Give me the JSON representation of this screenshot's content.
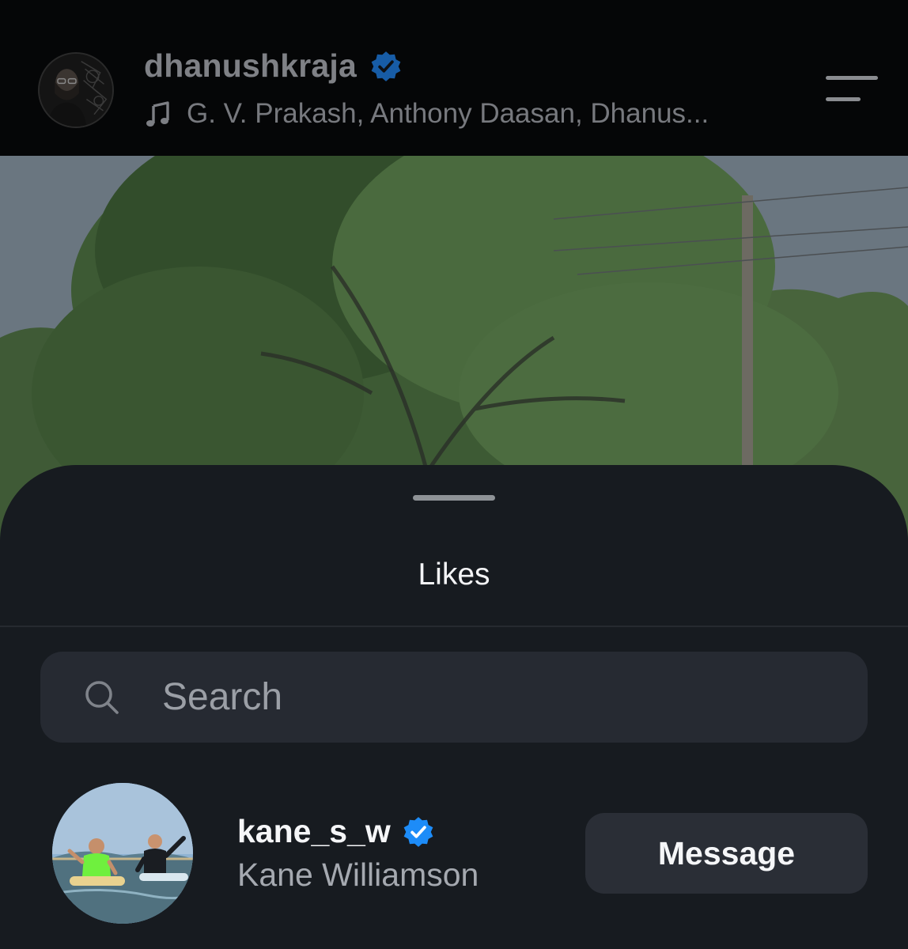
{
  "post_header": {
    "username": "dhanushkraja",
    "audio_text": "G. V. Prakash, Anthony Daasan, Dhanus...",
    "icons": {
      "verified": "verified-badge-icon",
      "music": "music-note-icon",
      "menu": "menu-lines-icon"
    }
  },
  "likes_sheet": {
    "title": "Likes",
    "search": {
      "placeholder": "Search",
      "value": ""
    },
    "rows": [
      {
        "username": "kane_s_w",
        "full_name": "Kane Williamson",
        "button_label": "Message"
      }
    ]
  },
  "colors": {
    "verified_blue": "#1d6ff2",
    "sheet_background": "#171b20",
    "search_background": "#262a32",
    "button_background": "#2a2e36"
  }
}
